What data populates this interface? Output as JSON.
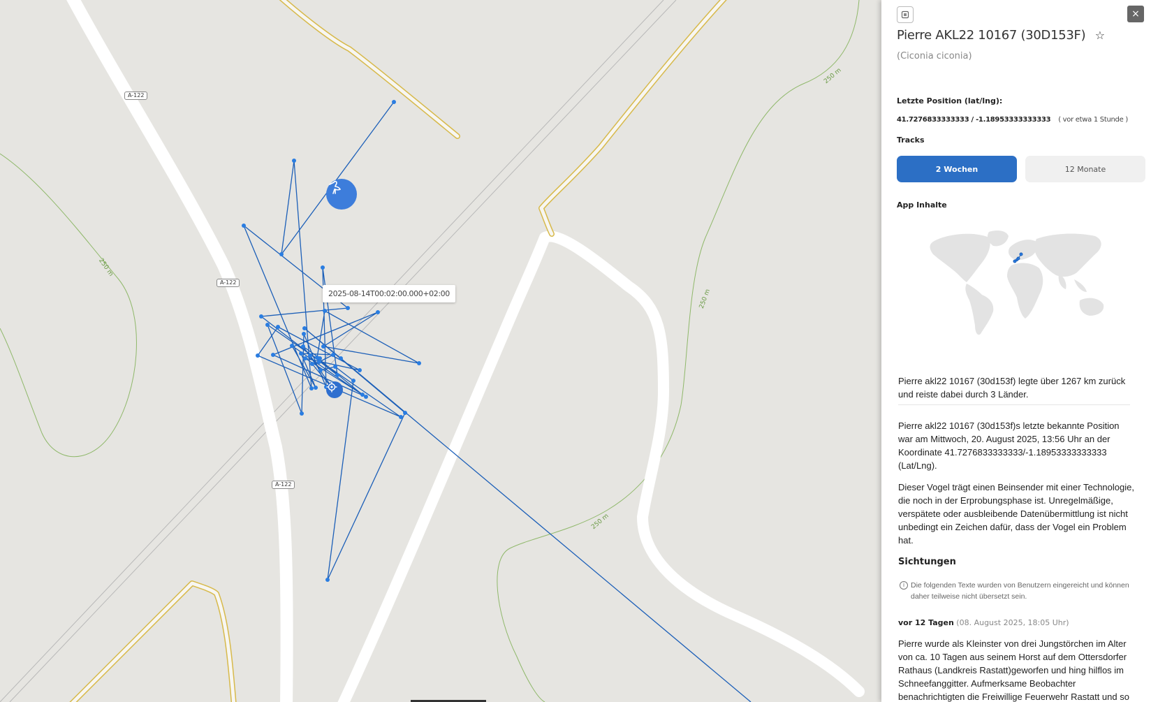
{
  "map": {
    "road_labels": [
      "A-122",
      "A-122",
      "A-122"
    ],
    "contour_labels": [
      "250 m",
      "250 m",
      "250 m",
      "250 m"
    ],
    "tooltip": "2025-08-14T00:02:00.000+02:00",
    "bird_icon": "stork-icon",
    "location_icon": "crosshair-icon",
    "track_color": "#1c5fb8",
    "point_color": "#2a7de1"
  },
  "panel": {
    "settings_icon": "square-icon",
    "close_label": "×",
    "title_first": "Pierre",
    "title_rest": "AKL22 10167 (30D153F)",
    "star_icon": "☆",
    "species": "(Ciconia ciconia)",
    "last_position_label": "Letzte Position (lat/lng):",
    "coords": "41.7276833333333 / -1.18953333333333",
    "ago": "( vor etwa 1 Stunde )",
    "tracks_label": "Tracks",
    "btn_2w": "2 Wochen",
    "btn_12m": "12 Monate",
    "app_label": "App Inhalte",
    "summary": "Pierre akl22 10167 (30d153f) legte über 1267 km zurück und reiste dabei durch 3 Länder.",
    "last_known": "Pierre akl22 10167 (30d153f)s letzte bekannte Position war am Mittwoch, 20. August 2025, 13:56 Uhr an der Koordinate 41.7276833333333/-1.18953333333333 (Lat/Lng).",
    "transmitter": "Dieser Vogel trägt einen Beinsender mit einer Technologie, die noch in der Erprobungsphase ist. Unregelmäßige, verspätete oder ausbleibende Datenübermittlung ist nicht unbedingt ein Zeichen dafür, dass der Vogel ein Problem hat.",
    "sightings_label": "Sichtungen",
    "notice": "Die folgenden Texte wurden von Benutzern eingereicht und können daher teilweise nicht übersetzt sein.",
    "sighting_ago": "vor 12 Tagen",
    "sighting_date": "(08. August 2025, 18:05 Uhr)",
    "sighting_text": "Pierre wurde als Kleinster von drei Jungstörchen im Alter von ca. 10 Tagen aus seinem Horst auf dem Ottersdorfer Rathaus (Landkreis Rastatt)geworfen und hing hilflos im Schneefanggitter. Aufmerksame Beobachter benachrichtigten die Freiwillige Feuerwehr Rastatt und so"
  }
}
